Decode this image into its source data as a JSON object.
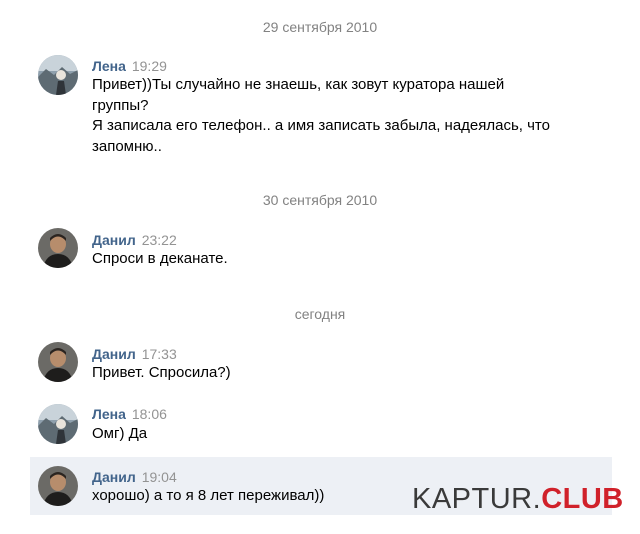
{
  "conversation": {
    "date_separators": [
      "29 сентября 2010",
      "30 сентября 2010",
      "сегодня"
    ],
    "messages": [
      {
        "author": "Лена",
        "time": "19:29",
        "lines": [
          "Привет))Ты случайно не знаешь, как зовут куратора нашей",
          "группы?",
          "Я записала его телефон.. а имя записать забыла, надеялась, что",
          "запомню.."
        ]
      },
      {
        "author": "Данил",
        "time": "23:22",
        "lines": [
          "Спроси в деканате."
        ]
      },
      {
        "author": "Данил",
        "time": "17:33",
        "lines": [
          "Привет. Спросила?)"
        ]
      },
      {
        "author": "Лена",
        "time": "18:06",
        "lines": [
          "Омг) Да"
        ]
      },
      {
        "author": "Данил",
        "time": "19:04",
        "lines": [
          "хорошо) а то я 8 лет переживал))"
        ]
      }
    ]
  },
  "watermark": {
    "main": "KAPTUR.",
    "accent": "CLUB"
  },
  "colors": {
    "author_name": "#42648b",
    "timestamp": "#939393",
    "date_separator": "#828282",
    "highlight_row": "#edf0f5",
    "watermark_accent": "#d0212a"
  }
}
